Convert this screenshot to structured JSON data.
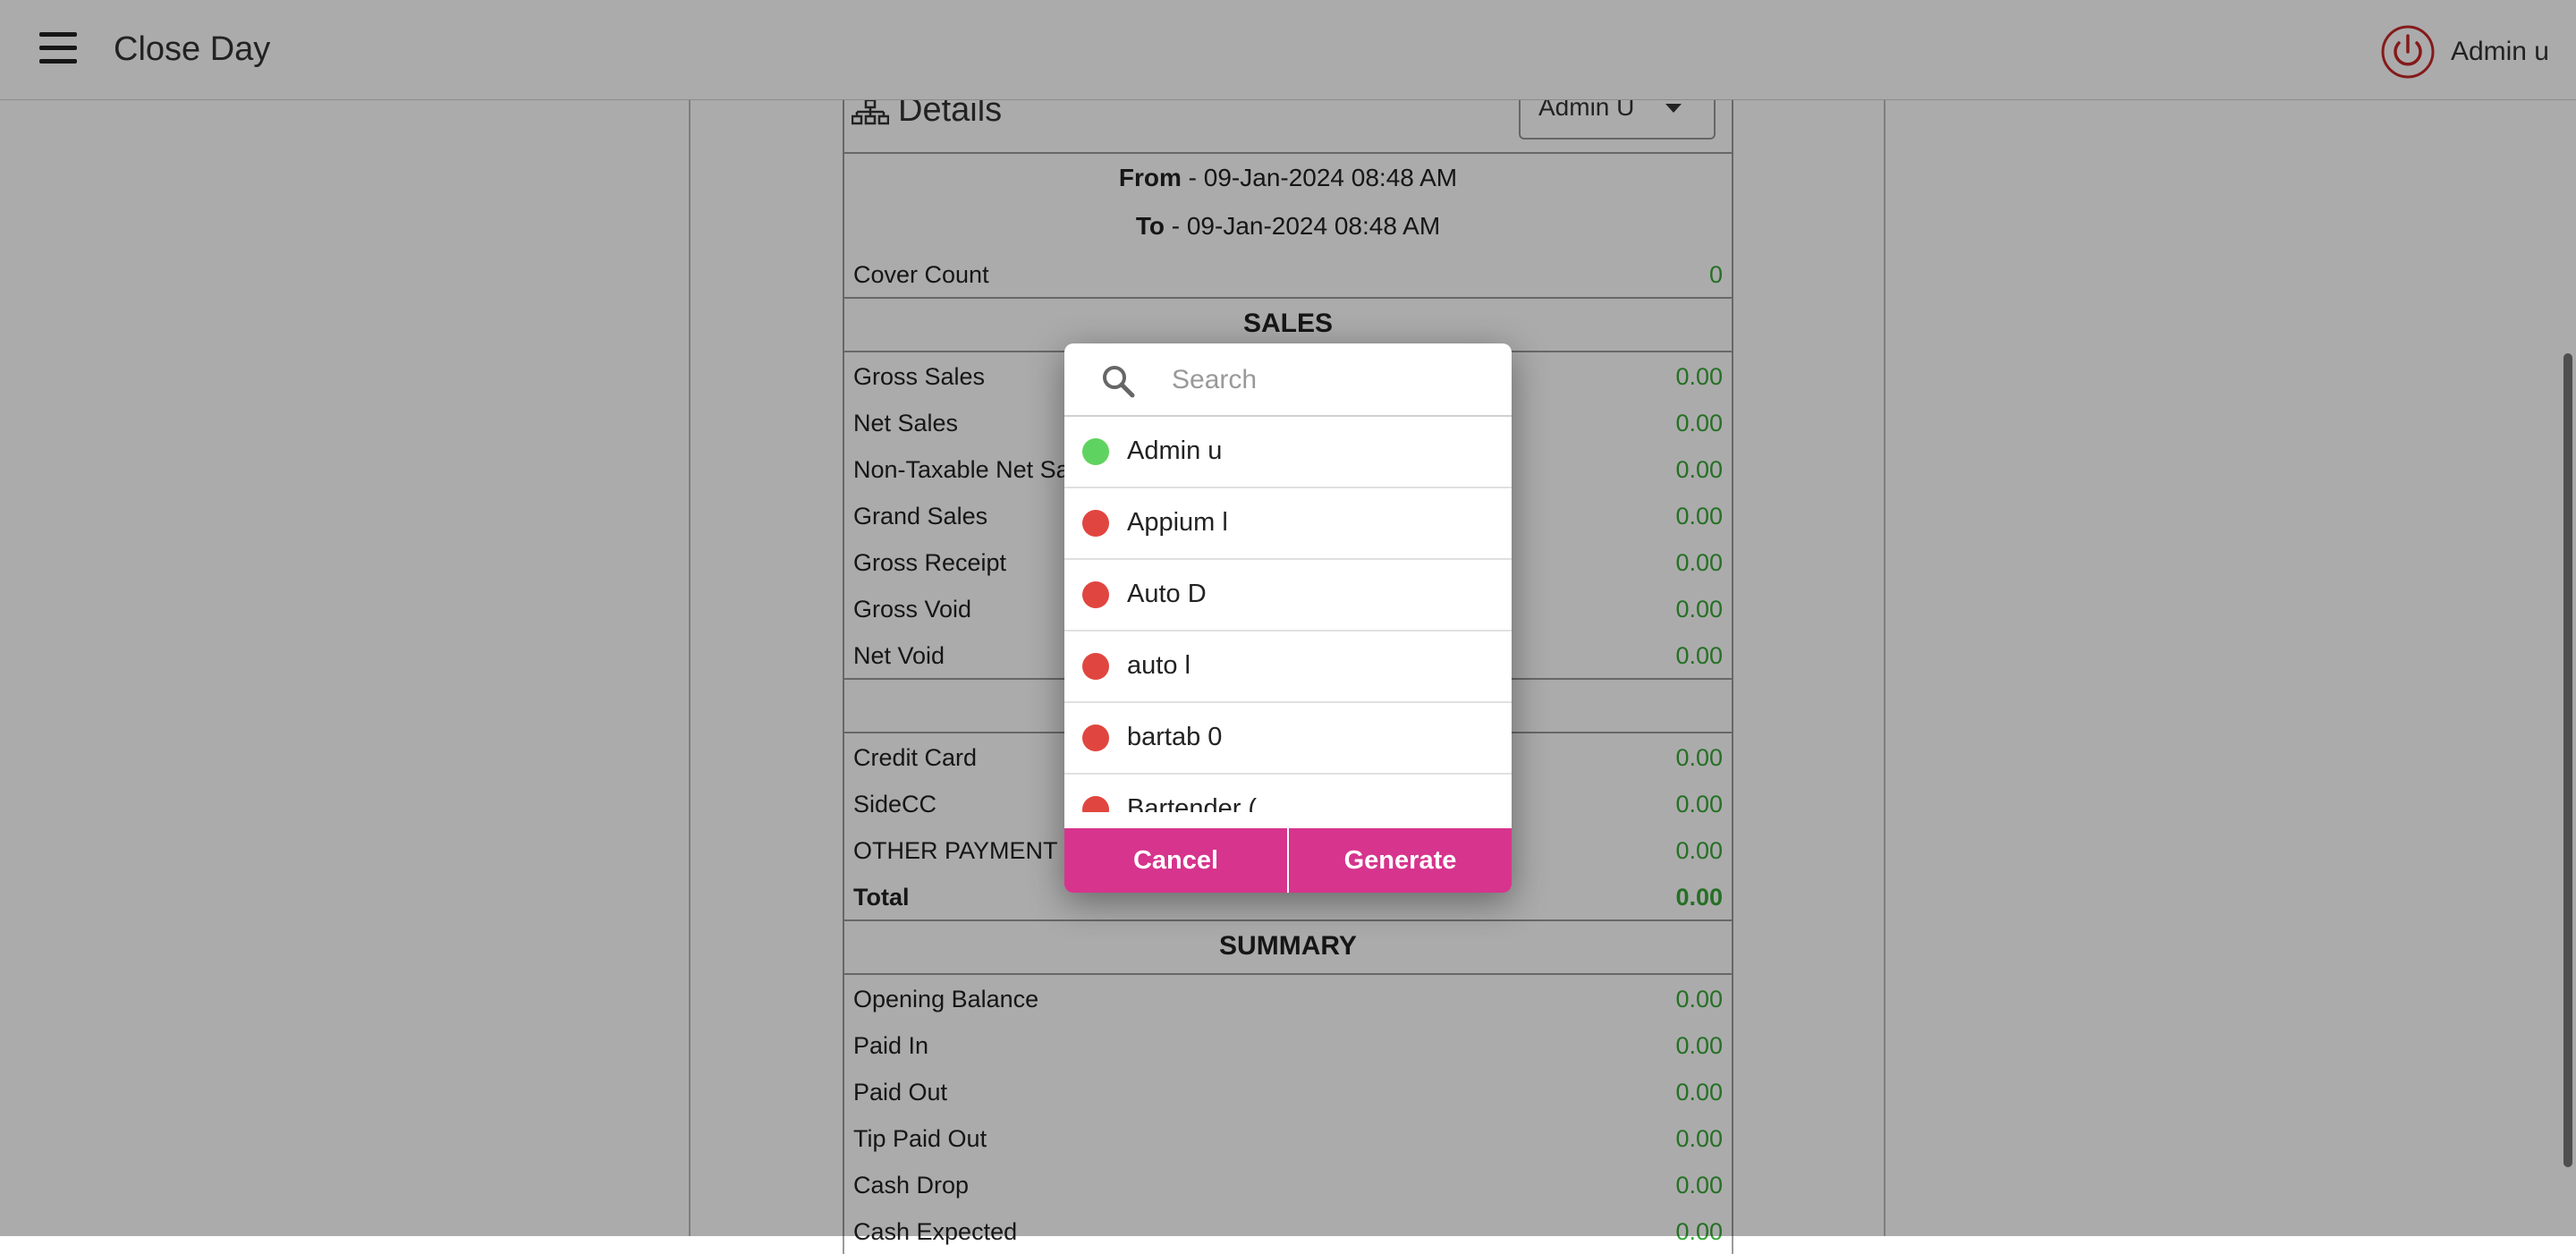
{
  "header": {
    "title": "Close Day",
    "user_name": "Admin u"
  },
  "report": {
    "title": "Details",
    "employee_selected": "Admin U",
    "from_label": "From",
    "from_value": " - 09-Jan-2024 08:48 AM",
    "to_label": "To",
    "to_value": " - 09-Jan-2024 08:48 AM",
    "cover_count_label": "Cover Count",
    "cover_count_value": "0",
    "sales_heading": "SALES",
    "sales_rows": [
      {
        "label": "Gross Sales",
        "value": "0.00"
      },
      {
        "label": "Net Sales",
        "value": "0.00"
      },
      {
        "label": "Non-Taxable Net Sal",
        "value": "0.00"
      },
      {
        "label": "Grand Sales",
        "value": "0.00"
      },
      {
        "label": "Gross Receipt",
        "value": "0.00"
      },
      {
        "label": "Gross Void",
        "value": "0.00"
      },
      {
        "label": "Net Void",
        "value": "0.00"
      }
    ],
    "payment_rows": [
      {
        "label": "Credit Card",
        "value": "0.00"
      },
      {
        "label": "SideCC",
        "value": "0.00"
      },
      {
        "label": "OTHER PAYMENT",
        "value": "0.00"
      },
      {
        "label": "Total",
        "value": "0.00"
      }
    ],
    "summary_heading": "SUMMARY",
    "summary_rows": [
      {
        "label": "Opening Balance",
        "value": "0.00"
      },
      {
        "label": "Paid In",
        "value": "0.00"
      },
      {
        "label": "Paid Out",
        "value": "0.00"
      },
      {
        "label": "Tip Paid Out",
        "value": "0.00"
      },
      {
        "label": "Cash Drop",
        "value": "0.00"
      },
      {
        "label": "Cash Expected",
        "value": "0.00"
      }
    ]
  },
  "modal": {
    "search_placeholder": "Search",
    "search_value": "",
    "items": [
      {
        "label": "Admin u",
        "status": "online"
      },
      {
        "label": "Appium l",
        "status": "offline"
      },
      {
        "label": "Auto D",
        "status": "offline"
      },
      {
        "label": "auto l",
        "status": "offline"
      },
      {
        "label": "bartab 0",
        "status": "offline"
      },
      {
        "label": "Bartender (",
        "status": "offline"
      }
    ],
    "cancel_label": "Cancel",
    "generate_label": "Generate"
  },
  "colors": {
    "accent": "#d6348d",
    "value_green": "#38a838",
    "status_online": "#5fd35f",
    "status_offline": "#e0463f",
    "power_red": "#c62828"
  },
  "icons": {
    "menu": "hamburger-icon",
    "power": "power-icon",
    "details": "sitemap-icon",
    "search": "search-icon"
  }
}
